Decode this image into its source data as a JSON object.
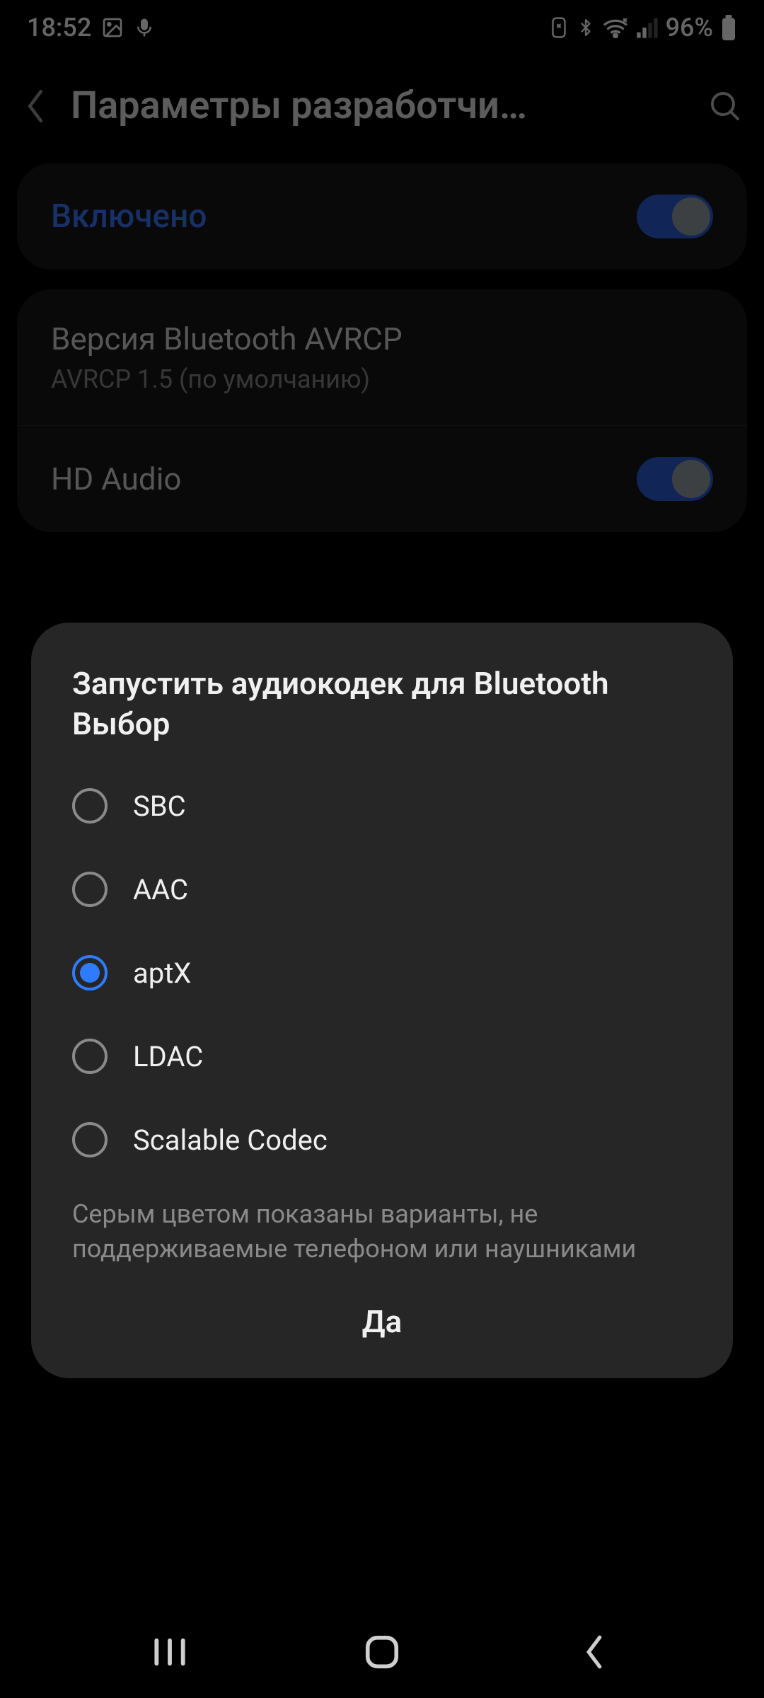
{
  "status": {
    "time": "18:52",
    "battery_pct": "96%"
  },
  "header": {
    "title": "Параметры разработчи…"
  },
  "enabled_card": {
    "label": "Включено",
    "toggle_on": true
  },
  "settings": {
    "avrcp": {
      "title": "Версия Bluetooth AVRCP",
      "sub": "AVRCP 1.5 (по умолчанию)"
    },
    "hd_audio": {
      "title": "HD Audio",
      "toggle_on": true
    }
  },
  "dialog": {
    "title": "Запустить аудиокодек для Bluetooth Выбор",
    "options": [
      {
        "label": "SBC",
        "selected": false
      },
      {
        "label": "AAC",
        "selected": false
      },
      {
        "label": "aptX",
        "selected": true
      },
      {
        "label": "LDAC",
        "selected": false
      },
      {
        "label": "Scalable Codec",
        "selected": false
      }
    ],
    "note": "Серым цветом показаны варианты, не поддерживаемые телефоном или наушниками",
    "confirm": "Да"
  }
}
